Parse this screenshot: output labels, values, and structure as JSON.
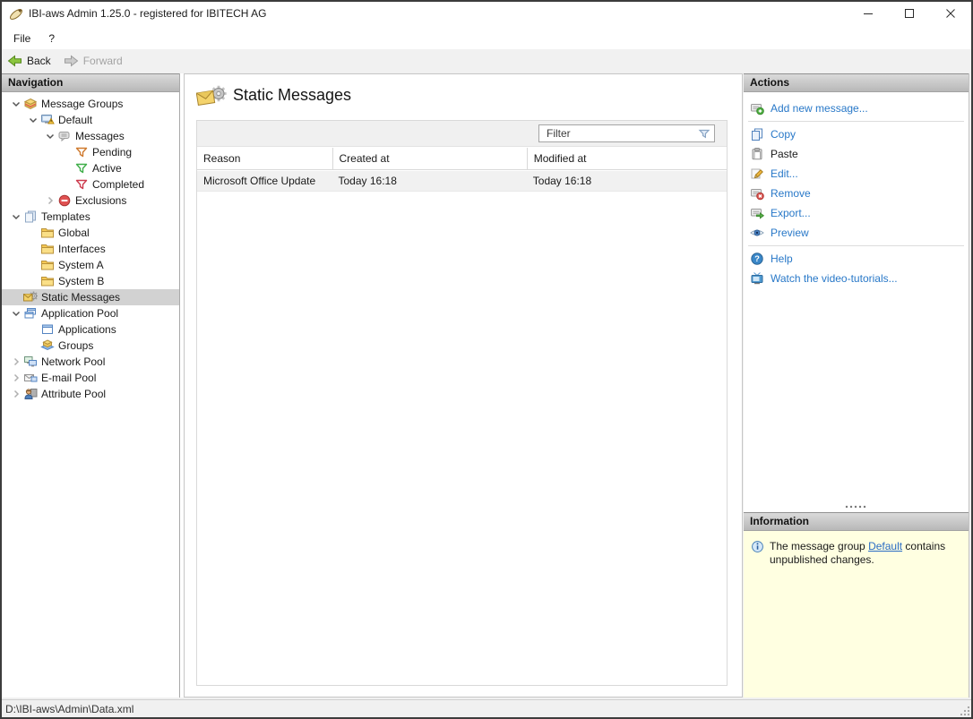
{
  "window": {
    "title": "IBI-aws Admin 1.25.0 - registered for IBITECH AG",
    "controls": [
      {
        "name": "minimize"
      },
      {
        "name": "maximize"
      },
      {
        "name": "close"
      }
    ]
  },
  "menubar": {
    "items": [
      "File",
      "?"
    ]
  },
  "toolbar": {
    "buttons": [
      {
        "label": "Back",
        "icon": "back-arrow",
        "enabled": true
      },
      {
        "label": "Forward",
        "icon": "forward-arrow",
        "enabled": false
      }
    ]
  },
  "navigation": {
    "header": "Navigation",
    "tree": [
      {
        "label": "Message Groups",
        "level": 0,
        "state": "expanded",
        "icon": "message-groups",
        "selected": false
      },
      {
        "label": "Default",
        "level": 1,
        "state": "expanded",
        "icon": "default-group",
        "selected": false
      },
      {
        "label": "Messages",
        "level": 2,
        "state": "expanded",
        "icon": "messages",
        "selected": false
      },
      {
        "label": "Pending",
        "level": 3,
        "state": "leaf",
        "icon": "funnel-pending",
        "selected": false
      },
      {
        "label": "Active",
        "level": 3,
        "state": "leaf",
        "icon": "funnel-active",
        "selected": false
      },
      {
        "label": "Completed",
        "level": 3,
        "state": "leaf",
        "icon": "funnel-completed",
        "selected": false
      },
      {
        "label": "Exclusions",
        "level": 2,
        "state": "collapsed",
        "icon": "exclusions",
        "selected": false
      },
      {
        "label": "Templates",
        "level": 0,
        "state": "expanded",
        "icon": "templates",
        "selected": false
      },
      {
        "label": "Global",
        "level": 1,
        "state": "leaf",
        "icon": "folder",
        "selected": false
      },
      {
        "label": "Interfaces",
        "level": 1,
        "state": "leaf",
        "icon": "folder",
        "selected": false
      },
      {
        "label": "System A",
        "level": 1,
        "state": "leaf",
        "icon": "folder",
        "selected": false
      },
      {
        "label": "System B",
        "level": 1,
        "state": "leaf",
        "icon": "folder",
        "selected": false
      },
      {
        "label": "Static Messages",
        "level": 0,
        "state": "leaf",
        "icon": "static-messages",
        "selected": true
      },
      {
        "label": "Application Pool",
        "level": 0,
        "state": "expanded",
        "icon": "application-pool",
        "selected": false
      },
      {
        "label": "Applications",
        "level": 1,
        "state": "leaf",
        "icon": "applications",
        "selected": false
      },
      {
        "label": "Groups",
        "level": 1,
        "state": "leaf",
        "icon": "groups",
        "selected": false
      },
      {
        "label": "Network Pool",
        "level": 0,
        "state": "collapsed",
        "icon": "network-pool",
        "selected": false
      },
      {
        "label": "E-mail Pool",
        "level": 0,
        "state": "collapsed",
        "icon": "email-pool",
        "selected": false
      },
      {
        "label": "Attribute Pool",
        "level": 0,
        "state": "collapsed",
        "icon": "attribute-pool",
        "selected": false
      }
    ]
  },
  "main": {
    "title": "Static Messages",
    "icon": "static-messages-large",
    "filter": {
      "placeholder": "Filter",
      "icon": "filter-funnel"
    },
    "table": {
      "columns": [
        "Reason",
        "Created at",
        "Modified at"
      ],
      "rows": [
        [
          "Microsoft Office Update",
          "Today 16:18",
          "Today 16:18"
        ]
      ]
    }
  },
  "actions": {
    "header": "Actions",
    "items": [
      {
        "label": "Add new message...",
        "icon": "message-add",
        "style": "link",
        "separator_after": true
      },
      {
        "label": "Copy",
        "icon": "copy",
        "style": "link",
        "separator_after": false
      },
      {
        "label": "Paste",
        "icon": "paste",
        "style": "disabled",
        "separator_after": false
      },
      {
        "label": "Edit...",
        "icon": "edit",
        "style": "link",
        "separator_after": false
      },
      {
        "label": "Remove",
        "icon": "message-remove",
        "style": "link",
        "separator_after": false
      },
      {
        "label": "Export...",
        "icon": "message-export",
        "style": "link",
        "separator_after": false
      },
      {
        "label": "Preview",
        "icon": "preview-eye",
        "style": "link",
        "separator_after": true
      },
      {
        "label": "Help",
        "icon": "help",
        "style": "link",
        "separator_after": false
      },
      {
        "label": "Watch the video-tutorials...",
        "icon": "video-tv",
        "style": "link",
        "separator_after": false
      }
    ]
  },
  "information": {
    "header": "Information",
    "icon": "info",
    "text_before": "The message group ",
    "link_text": "Default",
    "text_after": " contains unpublished changes."
  },
  "statusbar": {
    "path": "D:\\IBI-aws\\Admin\\Data.xml"
  },
  "colors": {
    "link": "#2878c8",
    "selection": "#d2d2d2",
    "info_bg": "#ffffe1"
  }
}
